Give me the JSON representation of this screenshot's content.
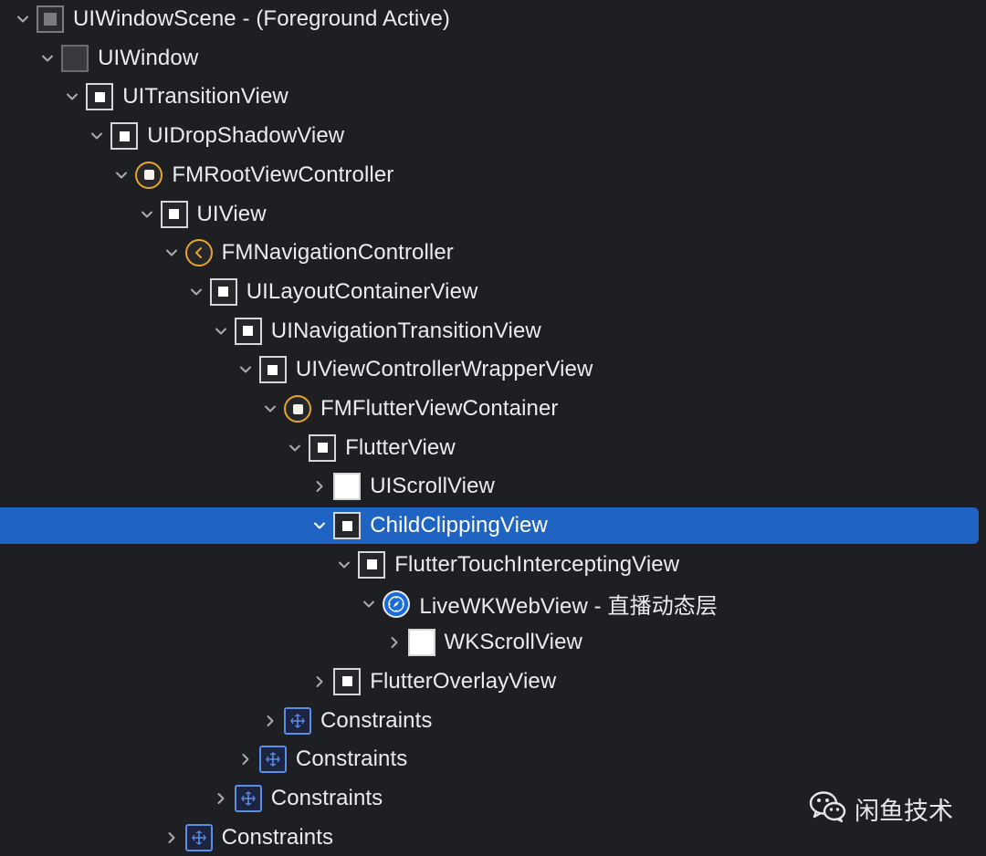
{
  "tree": {
    "rows": [
      {
        "label": "UIWindowScene - (Foreground Active)",
        "icon": "scene-icon",
        "expanded": true,
        "depth": 0,
        "selected": false
      },
      {
        "label": "UIWindow",
        "icon": "window-icon",
        "expanded": true,
        "depth": 1,
        "selected": false
      },
      {
        "label": "UITransitionView",
        "icon": "view-icon",
        "expanded": true,
        "depth": 2,
        "selected": false
      },
      {
        "label": "UIDropShadowView",
        "icon": "view-icon",
        "expanded": true,
        "depth": 3,
        "selected": false
      },
      {
        "label": "FMRootViewController",
        "icon": "view-controller-icon",
        "expanded": true,
        "depth": 4,
        "selected": false
      },
      {
        "label": "UIView",
        "icon": "view-icon",
        "expanded": true,
        "depth": 5,
        "selected": false
      },
      {
        "label": "FMNavigationController",
        "icon": "navigation-controller-icon",
        "expanded": true,
        "depth": 6,
        "selected": false
      },
      {
        "label": "UILayoutContainerView",
        "icon": "view-icon",
        "expanded": true,
        "depth": 7,
        "selected": false
      },
      {
        "label": "UINavigationTransitionView",
        "icon": "view-icon",
        "expanded": true,
        "depth": 8,
        "selected": false
      },
      {
        "label": "UIViewControllerWrapperView",
        "icon": "view-icon",
        "expanded": true,
        "depth": 9,
        "selected": false
      },
      {
        "label": "FMFlutterViewContainer",
        "icon": "view-controller-icon",
        "expanded": true,
        "depth": 10,
        "selected": false
      },
      {
        "label": "FlutterView",
        "icon": "view-icon",
        "expanded": true,
        "depth": 11,
        "selected": false
      },
      {
        "label": "UIScrollView",
        "icon": "filled-view-icon",
        "expanded": false,
        "depth": 12,
        "selected": false
      },
      {
        "label": "ChildClippingView",
        "icon": "view-icon",
        "expanded": true,
        "depth": 12,
        "selected": true
      },
      {
        "label": "FlutterTouchInterceptingView",
        "icon": "view-icon",
        "expanded": true,
        "depth": 13,
        "selected": false
      },
      {
        "label": "LiveWKWebView - 直播动态层",
        "icon": "webview-icon",
        "expanded": true,
        "depth": 14,
        "selected": false
      },
      {
        "label": "WKScrollView",
        "icon": "filled-view-icon",
        "expanded": false,
        "depth": 15,
        "selected": false
      },
      {
        "label": "FlutterOverlayView",
        "icon": "view-icon",
        "expanded": false,
        "depth": 12,
        "selected": false
      },
      {
        "label": "Constraints",
        "icon": "constraints-icon",
        "expanded": false,
        "depth": 10,
        "selected": false
      },
      {
        "label": "Constraints",
        "icon": "constraints-icon",
        "expanded": false,
        "depth": 9,
        "selected": false
      },
      {
        "label": "Constraints",
        "icon": "constraints-icon",
        "expanded": false,
        "depth": 8,
        "selected": false
      },
      {
        "label": "Constraints",
        "icon": "constraints-icon",
        "expanded": false,
        "depth": 6,
        "selected": false
      }
    ]
  },
  "watermark": {
    "text": "闲鱼技术",
    "icon": "wechat-icon"
  },
  "colors": {
    "background": "#1e1f23",
    "selection": "#1f64c3",
    "accent_orange": "#e7a52a",
    "constraints_blue": "#5b8ee6"
  }
}
